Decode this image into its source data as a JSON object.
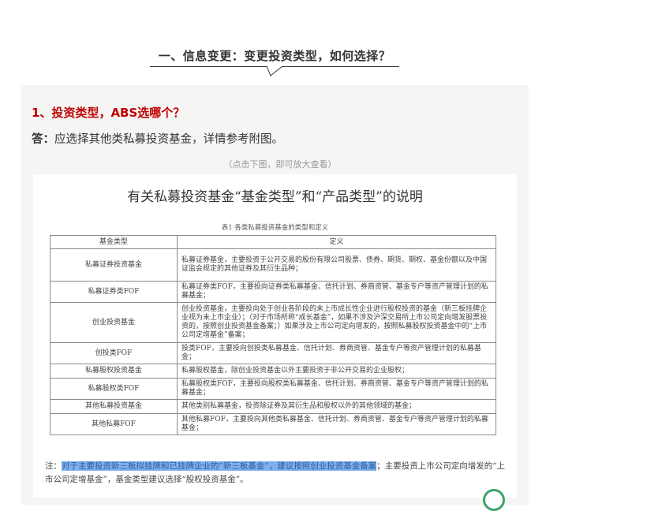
{
  "section": {
    "title": "一、信息变更：变更投资类型，如何选择？"
  },
  "question": {
    "title": "1、投资类型，ABS选哪个？",
    "answer_label": "答：",
    "answer_text": "应选择其他类私募投资基金，详情参考附图。",
    "hint": "（点击下图，即可放大查看）"
  },
  "document": {
    "title": "有关私募投资基金“基金类型”和“产品类型”的说明",
    "table_caption": "表1 各类私募投资基金的类型和定义",
    "headers": [
      "基金类型",
      "定义"
    ],
    "rows": [
      {
        "name": "私募证券投资基金",
        "definition": "私募证券基金，主要投资于公开交易的股份有限公司股票、债券、期货、期权、基金份额以及中国证监会规定的其他证券及其衍生品种；"
      },
      {
        "name": "私募证券类FOF",
        "definition": "私募证券类FOF，主要投向证券类私募基金、信托计划、券商资管、基金专户等资产管理计划的私募基金；"
      },
      {
        "name": "创业投资基金",
        "definition": "创业投资基金，主要投向处于创业各阶段的未上市成长性企业进行股权投资的基金（新三板挂牌企业视为未上市企业）；（对于市场所称“成长基金”，如果不涉及沪深交易所上市公司定向增发股票投资的，按照创业投资基金备案；）如果涉及上市公司定向增发的，按照私募股权投资基金中的“上市公司定增基金”备案；"
      },
      {
        "name": "创投类FOF",
        "definition": "投类FOF，主要投向创投类私募基金、信托计划、券商资管、基金专户等资产管理计划的私募基金；"
      },
      {
        "name": "私募股权投资基金",
        "definition": "私募股权基金，除创业投资基金以外主要投资于非公开交易的企业股权；"
      },
      {
        "name": "私募股权类FOF",
        "definition": "私募股权类FOF，主要投向股权类私募基金、信托计划、券商资管、基金专户等资产管理计划的私募基金；"
      },
      {
        "name": "其他私募投资基金",
        "definition": "其他类别私募基金，投资除证券及其衍生品和股权以外的其他领域的基金；"
      },
      {
        "name": "其他私募FOF",
        "definition": "其他私募FOF，主要投向其他类私募基金、信托计划、券商资管、基金专户等资产管理计划的私募基金；"
      }
    ],
    "note_label": "注：",
    "note_highlight": "对于主要投资新三板拟挂牌和已挂牌企业的“新三板基金”，建议按照创业投资基金备案",
    "note_rest": "；主要投资上市公司定向增发的“上市公司定增基金”，基金类型建议选择“股权投资基金”。"
  },
  "colors": {
    "accent_red": "#c00000",
    "highlight": "#7fb1ef",
    "panel_bg": "#f5f5f3"
  }
}
